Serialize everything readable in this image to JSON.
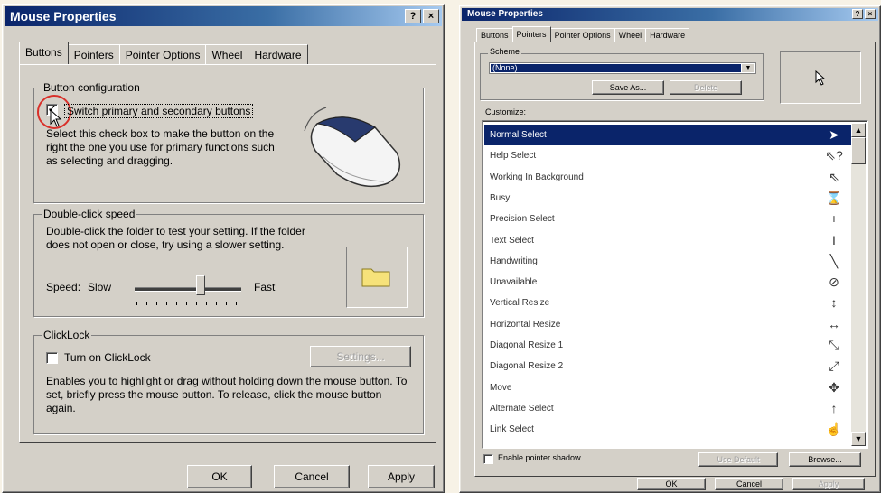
{
  "left": {
    "title": "Mouse Properties",
    "help_glyph": "?",
    "close_glyph": "×",
    "tabs": [
      "Buttons",
      "Pointers",
      "Pointer Options",
      "Wheel",
      "Hardware"
    ],
    "button_config": {
      "title": "Button configuration",
      "checkbox_label": "Switch primary and secondary buttons",
      "checked": true,
      "description": "Select this check box to make the button on the right the one you use for primary functions such as selecting and dragging."
    },
    "double_click": {
      "title": "Double-click speed",
      "description": "Double-click the folder to test your setting. If the folder does not open or close, try using a slower setting.",
      "speed_label": "Speed:",
      "slow_label": "Slow",
      "fast_label": "Fast",
      "slider_value": 0.62
    },
    "clicklock": {
      "title": "ClickLock",
      "checkbox_label": "Turn on ClickLock",
      "checked": false,
      "settings_button": "Settings...",
      "description": "Enables you to highlight or drag without holding down the mouse button. To set, briefly press the mouse button. To release, click the mouse button again."
    },
    "buttons": {
      "ok": "OK",
      "cancel": "Cancel",
      "apply": "Apply"
    }
  },
  "right": {
    "title": "Mouse Properties",
    "help_glyph": "?",
    "close_glyph": "×",
    "tabs": [
      "Buttons",
      "Pointers",
      "Pointer Options",
      "Wheel",
      "Hardware"
    ],
    "scheme_label": "Scheme",
    "scheme_value": "(None)",
    "save_as_button": "Save As...",
    "delete_button": "Delete",
    "customize_label": "Customize:",
    "pointers": [
      {
        "name": "Normal Select",
        "icon": "arrow-cursor",
        "glyph": "➤"
      },
      {
        "name": "Help Select",
        "icon": "help-cursor",
        "glyph": "⇖?"
      },
      {
        "name": "Working In Background",
        "icon": "busy-arrow-cursor",
        "glyph": "⇖⌛"
      },
      {
        "name": "Busy",
        "icon": "hourglass-cursor",
        "glyph": "⌛"
      },
      {
        "name": "Precision Select",
        "icon": "crosshair-cursor",
        "glyph": "+"
      },
      {
        "name": "Text Select",
        "icon": "ibeam-cursor",
        "glyph": "I"
      },
      {
        "name": "Handwriting",
        "icon": "pen-cursor",
        "glyph": "╲"
      },
      {
        "name": "Unavailable",
        "icon": "no-cursor",
        "glyph": "⊘"
      },
      {
        "name": "Vertical Resize",
        "icon": "vertical-resize-cursor",
        "glyph": "↕"
      },
      {
        "name": "Horizontal Resize",
        "icon": "horizontal-resize-cursor",
        "glyph": "↔"
      },
      {
        "name": "Diagonal Resize 1",
        "icon": "diagonal-resize-1-cursor",
        "glyph": "⤡"
      },
      {
        "name": "Diagonal Resize 2",
        "icon": "diagonal-resize-2-cursor",
        "glyph": "⤢"
      },
      {
        "name": "Move",
        "icon": "move-cursor",
        "glyph": "✥"
      },
      {
        "name": "Alternate Select",
        "icon": "up-arrow-cursor",
        "glyph": "↑"
      },
      {
        "name": "Link Select",
        "icon": "hand-cursor",
        "glyph": "☝"
      }
    ],
    "selected_index": 0,
    "shadow_label": "Enable pointer shadow",
    "use_default_button": "Use Default",
    "browse_button": "Browse...",
    "buttons": {
      "ok": "OK",
      "cancel": "Cancel",
      "apply": "Apply"
    }
  }
}
